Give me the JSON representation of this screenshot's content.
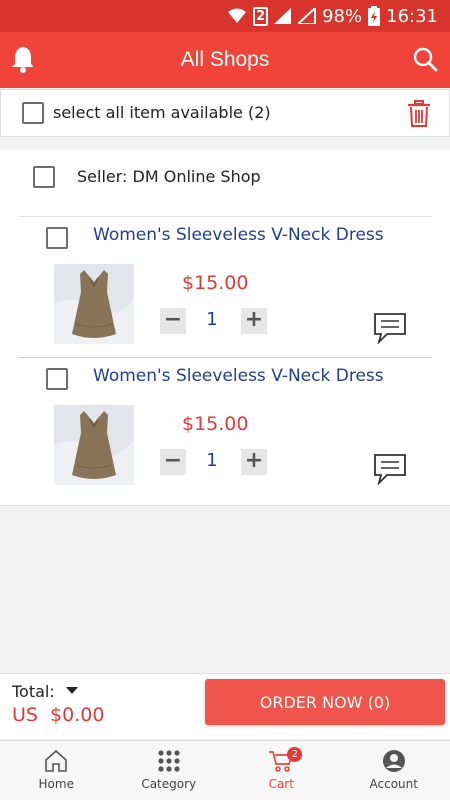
{
  "status_bar": {
    "sim_badge": "2",
    "battery": "98%",
    "time": "16:31"
  },
  "app_bar": {
    "title": "All Shops",
    "left_icon": "bell-icon",
    "right_icon": "search-icon"
  },
  "select_all": {
    "label": "select all item available (2)",
    "delete_icon": "trash-icon"
  },
  "seller": {
    "label": "Seller:  DM Online Shop"
  },
  "items": [
    {
      "name": "Women's Sleeveless V-Neck Dress",
      "price": "$15.00",
      "quantity": "1",
      "minus": "−",
      "plus": "+",
      "chat_icon": "chat-icon"
    },
    {
      "name": "Women's Sleeveless V-Neck Dress",
      "price": "$15.00",
      "quantity": "1",
      "minus": "−",
      "plus": "+",
      "chat_icon": "chat-icon"
    }
  ],
  "footer": {
    "total_label": "Total:",
    "total_value": "US  $0.00",
    "order_button": "ORDER NOW (0)"
  },
  "bottom_nav": [
    {
      "label": "Home",
      "icon": "home-icon"
    },
    {
      "label": "Category",
      "icon": "grid-icon"
    },
    {
      "label": "Cart",
      "icon": "cart-icon",
      "badge": "2",
      "active": true
    },
    {
      "label": "Account",
      "icon": "account-icon"
    }
  ],
  "colors": {
    "status_bar": "#d9342b",
    "app_bar": "#f0443a",
    "price": "#e53935",
    "product_name": "#1f3f8f",
    "order_button": "#f0554b"
  }
}
